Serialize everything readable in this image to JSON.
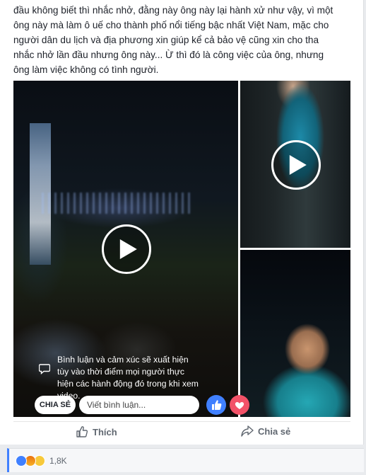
{
  "post": {
    "lines": [
      "đầu không biết thì nhắc nhở, đằng này ông này lại hành xử như vậy, vì một",
      "ông này mà làm ô uế cho thành phố nổi tiếng bậc nhất Việt Nam, mặc cho",
      "người dân du lịch và địa phương xin giúp kể cả bảo vệ cũng xin cho tha",
      "nhắc nhở lần đầu nhưng ông này... Ừ thì đó là công việc của ông, nhưng",
      "ông làm việc không có tình người."
    ]
  },
  "video_overlay": {
    "comment_hint": "Bình luận và cảm xúc sẽ xuất hiện tùy vào thời điểm mọi người thực hiện các hành động đó trong khi xem video.",
    "share_label": "CHIA SẺ",
    "comment_placeholder": "Viết bình luận..."
  },
  "actions": {
    "like_label": "Thích",
    "share_label": "Chia sẻ"
  },
  "reactions": {
    "types": [
      "like-icon",
      "angry-icon",
      "haha-icon"
    ],
    "count": "1,8K"
  },
  "colors": {
    "accent": "#4080ff",
    "love": "#f25268",
    "muted_text": "#606770"
  }
}
